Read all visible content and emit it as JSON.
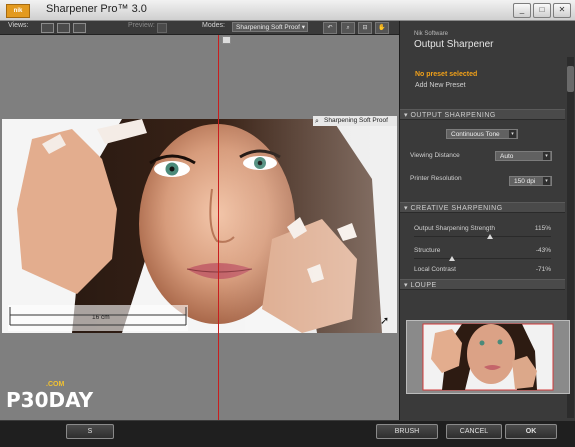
{
  "window": {
    "logo_text": "nik",
    "title": "Sharpener Pro™ 3.0",
    "controls": [
      "_",
      "□",
      "✕"
    ]
  },
  "toolbar": {
    "views_label": "Views:",
    "preview_label": "Preview:",
    "modes_label": "Modes:",
    "mode_value": "Sharpening Soft Proof",
    "arrow": "▾"
  },
  "canvas": {
    "softproof_label": "Sharpening Soft Proof",
    "ruler_label": "16 cm"
  },
  "watermark": {
    "top": ".COM",
    "main": "P30DAY"
  },
  "buttons": {
    "brush": "BRUSH",
    "cancel": "CANCEL",
    "ok": "OK",
    "left": "S"
  },
  "panel": {
    "vendor": "Nik Software",
    "title": "Output Sharpener",
    "preset_none": "No preset selected",
    "preset_add": "Add New Preset",
    "section_output": "▾ OUTPUT SHARPENING",
    "output_type": "Continuous Tone",
    "viewing_distance_label": "Viewing Distance",
    "viewing_distance_value": "Auto",
    "printer_resolution_label": "Printer Resolution",
    "printer_resolution_value": "150 dpi",
    "section_creative": "▾ CREATIVE SHARPENING",
    "sliders": [
      {
        "label": "Output Sharpening Strength",
        "value": "115%"
      },
      {
        "label": "Structure",
        "value": "-43%"
      },
      {
        "label": "Local Contrast",
        "value": "-71%"
      }
    ],
    "section_loupe": "▾ LOUPE"
  },
  "colors": {
    "accent": "#f0a019",
    "split_line": "#c81e1e"
  }
}
